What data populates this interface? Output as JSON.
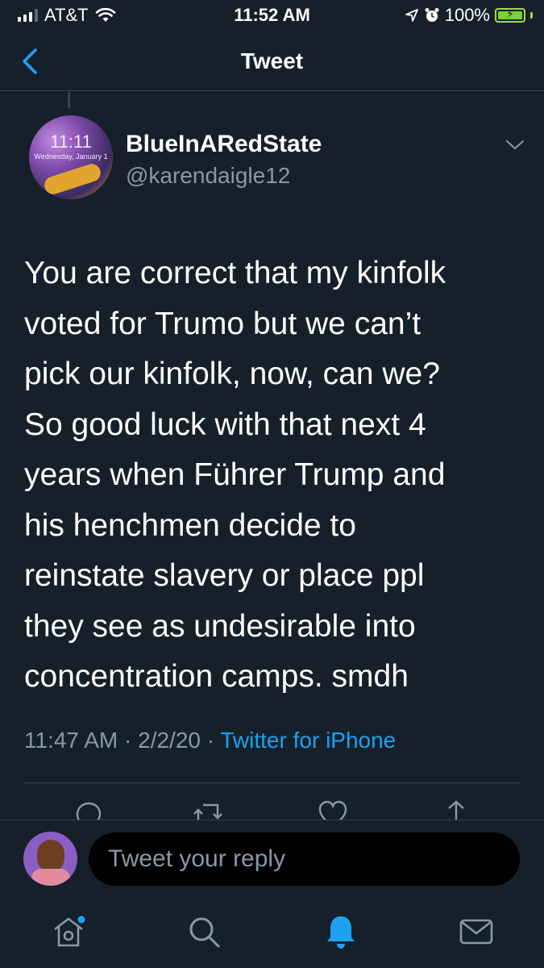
{
  "status_bar": {
    "carrier": "AT&T",
    "time": "11:52 AM",
    "battery": "100%"
  },
  "header": {
    "title": "Tweet",
    "back_icon": "chevron-left-icon"
  },
  "tweet": {
    "display_name": "BlueInARedState",
    "handle": "@karendaigle12",
    "avatar_time": "11:11",
    "avatar_date": "Wednesday, January 1",
    "text": "You are correct that my kinfolk\nvoted for Trumo but we can’t\npick our kinfolk, now, can we?\nSo good luck with that next 4\nyears when Führer Trump and\nhis henchmen decide to\nreinstate slavery or place ppl\nthey see as undesirable into\nconcentration camps.  smdh",
    "time": "11:47 AM",
    "date": "2/2/20",
    "source": "Twitter for iPhone",
    "separator": "·"
  },
  "reply": {
    "placeholder": "Tweet your reply"
  },
  "tabs": [
    {
      "icon": "home-icon"
    },
    {
      "icon": "search-icon"
    },
    {
      "icon": "notifications-icon"
    },
    {
      "icon": "messages-icon"
    }
  ],
  "colors": {
    "background": "#15202b",
    "accent": "#1da1f2",
    "secondary_text": "#8899a6",
    "divider": "#38444d"
  }
}
